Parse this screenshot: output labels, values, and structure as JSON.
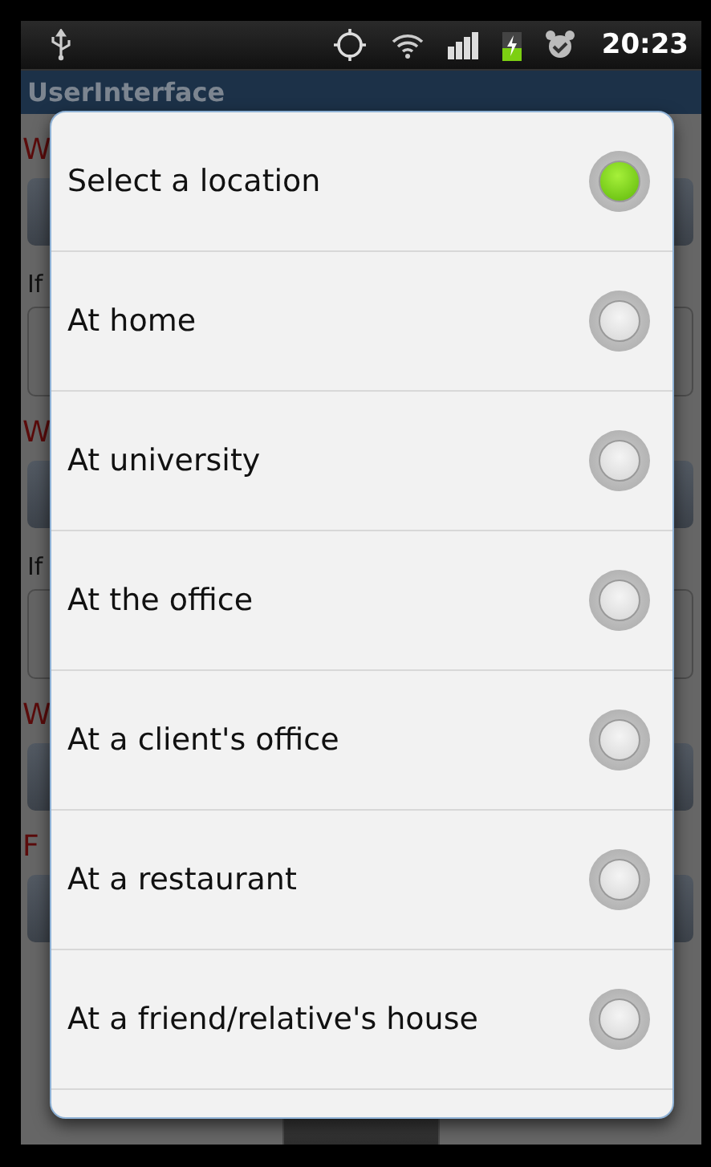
{
  "status_bar": {
    "time": "20:23"
  },
  "app_bar": {
    "title": "UserInterface"
  },
  "form": [
    {
      "kind": "label",
      "text": "W"
    },
    {
      "kind": "spinner"
    },
    {
      "kind": "hint",
      "text": "If"
    },
    {
      "kind": "field"
    },
    {
      "kind": "label",
      "text": "W"
    },
    {
      "kind": "spinner"
    },
    {
      "kind": "hint",
      "text": "If"
    },
    {
      "kind": "field"
    },
    {
      "kind": "label",
      "text": "W"
    },
    {
      "kind": "spinner"
    },
    {
      "kind": "label",
      "text": "F"
    },
    {
      "kind": "spinner"
    }
  ],
  "dialog": {
    "options": [
      {
        "label": "Select a location",
        "selected": true
      },
      {
        "label": "At home",
        "selected": false
      },
      {
        "label": "At university",
        "selected": false
      },
      {
        "label": "At the office",
        "selected": false
      },
      {
        "label": "At a client's office",
        "selected": false
      },
      {
        "label": "At a restaurant",
        "selected": false
      },
      {
        "label": "At a friend/relative's house",
        "selected": false
      }
    ]
  }
}
